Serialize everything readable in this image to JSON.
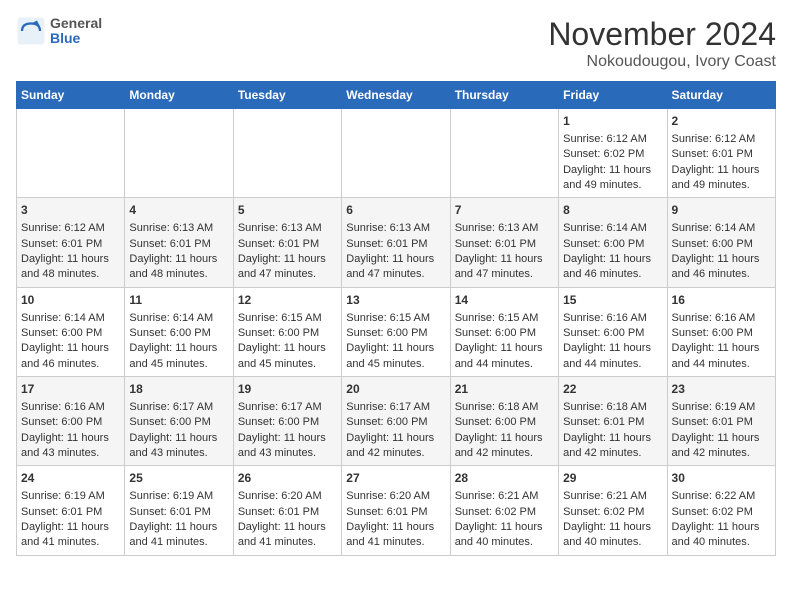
{
  "header": {
    "logo_line1": "General",
    "logo_line2": "Blue",
    "title": "November 2024",
    "subtitle": "Nokoudougou, Ivory Coast"
  },
  "weekdays": [
    "Sunday",
    "Monday",
    "Tuesday",
    "Wednesday",
    "Thursday",
    "Friday",
    "Saturday"
  ],
  "weeks": [
    [
      {
        "day": "",
        "info": ""
      },
      {
        "day": "",
        "info": ""
      },
      {
        "day": "",
        "info": ""
      },
      {
        "day": "",
        "info": ""
      },
      {
        "day": "",
        "info": ""
      },
      {
        "day": "1",
        "info": "Sunrise: 6:12 AM\nSunset: 6:02 PM\nDaylight: 11 hours and 49 minutes."
      },
      {
        "day": "2",
        "info": "Sunrise: 6:12 AM\nSunset: 6:01 PM\nDaylight: 11 hours and 49 minutes."
      }
    ],
    [
      {
        "day": "3",
        "info": "Sunrise: 6:12 AM\nSunset: 6:01 PM\nDaylight: 11 hours and 48 minutes."
      },
      {
        "day": "4",
        "info": "Sunrise: 6:13 AM\nSunset: 6:01 PM\nDaylight: 11 hours and 48 minutes."
      },
      {
        "day": "5",
        "info": "Sunrise: 6:13 AM\nSunset: 6:01 PM\nDaylight: 11 hours and 47 minutes."
      },
      {
        "day": "6",
        "info": "Sunrise: 6:13 AM\nSunset: 6:01 PM\nDaylight: 11 hours and 47 minutes."
      },
      {
        "day": "7",
        "info": "Sunrise: 6:13 AM\nSunset: 6:01 PM\nDaylight: 11 hours and 47 minutes."
      },
      {
        "day": "8",
        "info": "Sunrise: 6:14 AM\nSunset: 6:00 PM\nDaylight: 11 hours and 46 minutes."
      },
      {
        "day": "9",
        "info": "Sunrise: 6:14 AM\nSunset: 6:00 PM\nDaylight: 11 hours and 46 minutes."
      }
    ],
    [
      {
        "day": "10",
        "info": "Sunrise: 6:14 AM\nSunset: 6:00 PM\nDaylight: 11 hours and 46 minutes."
      },
      {
        "day": "11",
        "info": "Sunrise: 6:14 AM\nSunset: 6:00 PM\nDaylight: 11 hours and 45 minutes."
      },
      {
        "day": "12",
        "info": "Sunrise: 6:15 AM\nSunset: 6:00 PM\nDaylight: 11 hours and 45 minutes."
      },
      {
        "day": "13",
        "info": "Sunrise: 6:15 AM\nSunset: 6:00 PM\nDaylight: 11 hours and 45 minutes."
      },
      {
        "day": "14",
        "info": "Sunrise: 6:15 AM\nSunset: 6:00 PM\nDaylight: 11 hours and 44 minutes."
      },
      {
        "day": "15",
        "info": "Sunrise: 6:16 AM\nSunset: 6:00 PM\nDaylight: 11 hours and 44 minutes."
      },
      {
        "day": "16",
        "info": "Sunrise: 6:16 AM\nSunset: 6:00 PM\nDaylight: 11 hours and 44 minutes."
      }
    ],
    [
      {
        "day": "17",
        "info": "Sunrise: 6:16 AM\nSunset: 6:00 PM\nDaylight: 11 hours and 43 minutes."
      },
      {
        "day": "18",
        "info": "Sunrise: 6:17 AM\nSunset: 6:00 PM\nDaylight: 11 hours and 43 minutes."
      },
      {
        "day": "19",
        "info": "Sunrise: 6:17 AM\nSunset: 6:00 PM\nDaylight: 11 hours and 43 minutes."
      },
      {
        "day": "20",
        "info": "Sunrise: 6:17 AM\nSunset: 6:00 PM\nDaylight: 11 hours and 42 minutes."
      },
      {
        "day": "21",
        "info": "Sunrise: 6:18 AM\nSunset: 6:00 PM\nDaylight: 11 hours and 42 minutes."
      },
      {
        "day": "22",
        "info": "Sunrise: 6:18 AM\nSunset: 6:01 PM\nDaylight: 11 hours and 42 minutes."
      },
      {
        "day": "23",
        "info": "Sunrise: 6:19 AM\nSunset: 6:01 PM\nDaylight: 11 hours and 42 minutes."
      }
    ],
    [
      {
        "day": "24",
        "info": "Sunrise: 6:19 AM\nSunset: 6:01 PM\nDaylight: 11 hours and 41 minutes."
      },
      {
        "day": "25",
        "info": "Sunrise: 6:19 AM\nSunset: 6:01 PM\nDaylight: 11 hours and 41 minutes."
      },
      {
        "day": "26",
        "info": "Sunrise: 6:20 AM\nSunset: 6:01 PM\nDaylight: 11 hours and 41 minutes."
      },
      {
        "day": "27",
        "info": "Sunrise: 6:20 AM\nSunset: 6:01 PM\nDaylight: 11 hours and 41 minutes."
      },
      {
        "day": "28",
        "info": "Sunrise: 6:21 AM\nSunset: 6:02 PM\nDaylight: 11 hours and 40 minutes."
      },
      {
        "day": "29",
        "info": "Sunrise: 6:21 AM\nSunset: 6:02 PM\nDaylight: 11 hours and 40 minutes."
      },
      {
        "day": "30",
        "info": "Sunrise: 6:22 AM\nSunset: 6:02 PM\nDaylight: 11 hours and 40 minutes."
      }
    ]
  ]
}
